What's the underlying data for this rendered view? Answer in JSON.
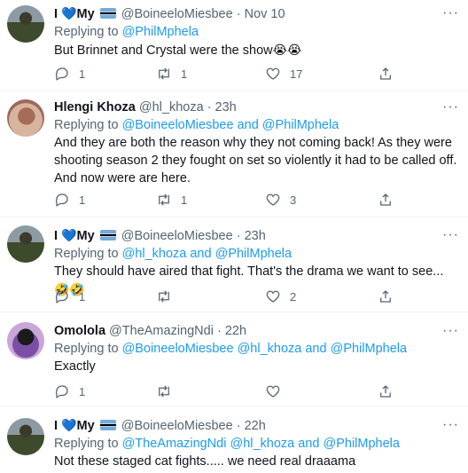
{
  "tweets": [
    {
      "name_prefix": "I",
      "heart": "💙",
      "name_suffix": "My",
      "handle": "@BoineeloMiesbee",
      "dot": "·",
      "time": "Nov 10",
      "replying_prefix": "Replying to ",
      "replying_users": "@PhilMphela",
      "replying_more": "",
      "text": "But Brinnet and Crystal were the show",
      "emoji": "😭😭",
      "replies": "1",
      "retweets": "1",
      "likes": "17"
    },
    {
      "name": "Hlengi Khoza",
      "handle": "@hl_khoza",
      "dot": "·",
      "time": "23h",
      "replying_prefix": "Replying to ",
      "replying_users": "@BoineeloMiesbee",
      "replying_and": " and ",
      "replying_more": "@PhilMphela",
      "text": "And they are both the reason why they not coming back! As they were shooting season 2 they fought on set so violently it had to be called off. And now were are here.",
      "replies": "1",
      "retweets": "1",
      "likes": "3"
    },
    {
      "name_prefix": "I",
      "heart": "💙",
      "name_suffix": "My",
      "handle": "@BoineeloMiesbee",
      "dot": "·",
      "time": "23h",
      "replying_prefix": "Replying to ",
      "replying_users": "@hl_khoza",
      "replying_and": " and ",
      "replying_more": "@PhilMphela",
      "text": "They should have aired that fight. That's the drama we want to see... ",
      "emoji": "🤣🤣",
      "replies": "1",
      "retweets": "",
      "likes": "2"
    },
    {
      "name": "Omolola",
      "handle": "@TheAmazingNdi",
      "dot": "·",
      "time": "22h",
      "replying_prefix": "Replying to ",
      "replying_users": "@BoineeloMiesbee @hl_khoza",
      "replying_and": " and ",
      "replying_more": "@PhilMphela",
      "text": "Exactly",
      "replies": "1",
      "retweets": "",
      "likes": ""
    },
    {
      "name_prefix": "I",
      "heart": "💙",
      "name_suffix": "My",
      "handle": "@BoineeloMiesbee",
      "dot": "·",
      "time": "22h",
      "replying_prefix": "Replying to ",
      "replying_users": "@TheAmazingNdi @hl_khoza",
      "replying_and": " and ",
      "replying_more": "@PhilMphela",
      "text": "Not these staged cat fights..... we need real draaama"
    }
  ],
  "more_label": "···"
}
